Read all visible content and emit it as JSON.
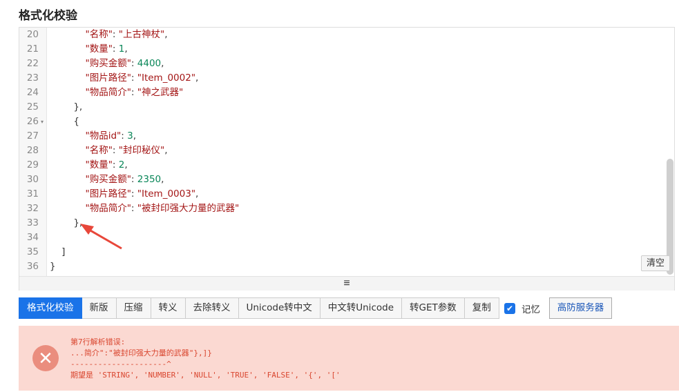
{
  "page": {
    "title": "格式化校验"
  },
  "editor": {
    "lines": [
      {
        "num": "20",
        "fold": "",
        "indent": "            ",
        "segments": [
          [
            "k",
            "\"名称\""
          ],
          [
            "p",
            ": "
          ],
          [
            "s",
            "\"上古神杖\""
          ],
          [
            "p",
            ","
          ]
        ]
      },
      {
        "num": "21",
        "fold": "",
        "indent": "            ",
        "segments": [
          [
            "k",
            "\"数量\""
          ],
          [
            "p",
            ": "
          ],
          [
            "n",
            "1"
          ],
          [
            "p",
            ","
          ]
        ]
      },
      {
        "num": "22",
        "fold": "",
        "indent": "            ",
        "segments": [
          [
            "k",
            "\"购买金额\""
          ],
          [
            "p",
            ": "
          ],
          [
            "n",
            "4400"
          ],
          [
            "p",
            ","
          ]
        ]
      },
      {
        "num": "23",
        "fold": "",
        "indent": "            ",
        "segments": [
          [
            "k",
            "\"图片路径\""
          ],
          [
            "p",
            ": "
          ],
          [
            "s",
            "\"Item_0002\""
          ],
          [
            "p",
            ","
          ]
        ]
      },
      {
        "num": "24",
        "fold": "",
        "indent": "            ",
        "segments": [
          [
            "k",
            "\"物品简介\""
          ],
          [
            "p",
            ": "
          ],
          [
            "s",
            "\"神之武器\""
          ]
        ]
      },
      {
        "num": "25",
        "fold": "",
        "indent": "        ",
        "segments": [
          [
            "p",
            "},"
          ]
        ]
      },
      {
        "num": "26",
        "fold": "▾",
        "indent": "        ",
        "segments": [
          [
            "p",
            "{"
          ]
        ]
      },
      {
        "num": "27",
        "fold": "",
        "indent": "            ",
        "segments": [
          [
            "k",
            "\"物品id\""
          ],
          [
            "p",
            ": "
          ],
          [
            "n",
            "3"
          ],
          [
            "p",
            ","
          ]
        ]
      },
      {
        "num": "28",
        "fold": "",
        "indent": "            ",
        "segments": [
          [
            "k",
            "\"名称\""
          ],
          [
            "p",
            ": "
          ],
          [
            "s",
            "\"封印秘仪\""
          ],
          [
            "p",
            ","
          ]
        ]
      },
      {
        "num": "29",
        "fold": "",
        "indent": "            ",
        "segments": [
          [
            "k",
            "\"数量\""
          ],
          [
            "p",
            ": "
          ],
          [
            "n",
            "2"
          ],
          [
            "p",
            ","
          ]
        ]
      },
      {
        "num": "30",
        "fold": "",
        "indent": "            ",
        "segments": [
          [
            "k",
            "\"购买金额\""
          ],
          [
            "p",
            ": "
          ],
          [
            "n",
            "2350"
          ],
          [
            "p",
            ","
          ]
        ]
      },
      {
        "num": "31",
        "fold": "",
        "indent": "            ",
        "segments": [
          [
            "k",
            "\"图片路径\""
          ],
          [
            "p",
            ": "
          ],
          [
            "s",
            "\"Item_0003\""
          ],
          [
            "p",
            ","
          ]
        ]
      },
      {
        "num": "32",
        "fold": "",
        "indent": "            ",
        "segments": [
          [
            "k",
            "\"物品简介\""
          ],
          [
            "p",
            ": "
          ],
          [
            "s",
            "\"被封印强大力量的武器\""
          ]
        ]
      },
      {
        "num": "33",
        "fold": "",
        "indent": "        ",
        "segments": [
          [
            "p",
            "},"
          ]
        ]
      },
      {
        "num": "34",
        "fold": "",
        "indent": "",
        "segments": []
      },
      {
        "num": "35",
        "fold": "",
        "indent": "    ",
        "segments": [
          [
            "p",
            "]"
          ]
        ]
      },
      {
        "num": "36",
        "fold": "",
        "indent": "",
        "segments": [
          [
            "p",
            "}"
          ]
        ]
      }
    ],
    "clear_label": "清空",
    "resize_icon": "≡"
  },
  "toolbar": {
    "buttons": [
      "格式化校验",
      "新版",
      "压缩",
      "转义",
      "去除转义",
      "Unicode转中文",
      "中文转Unicode",
      "转GET参数",
      "复制"
    ],
    "memory_label": "记忆",
    "memory_checked": true,
    "server_label": "高防服务器"
  },
  "error": {
    "icon": "close-circle-icon",
    "line1": "第7行解析错误:",
    "line2": "...简介\":\"被封印强大力量的武器\"},]}",
    "line3": "---------------------^",
    "line4": "期望是 'STRING', 'NUMBER', 'NULL', 'TRUE', 'FALSE', '{', '['"
  },
  "colors": {
    "accent": "#1a73e8",
    "error_bg": "#fbd9d2",
    "error_text": "#d9462f",
    "arrow": "#e8473a"
  }
}
